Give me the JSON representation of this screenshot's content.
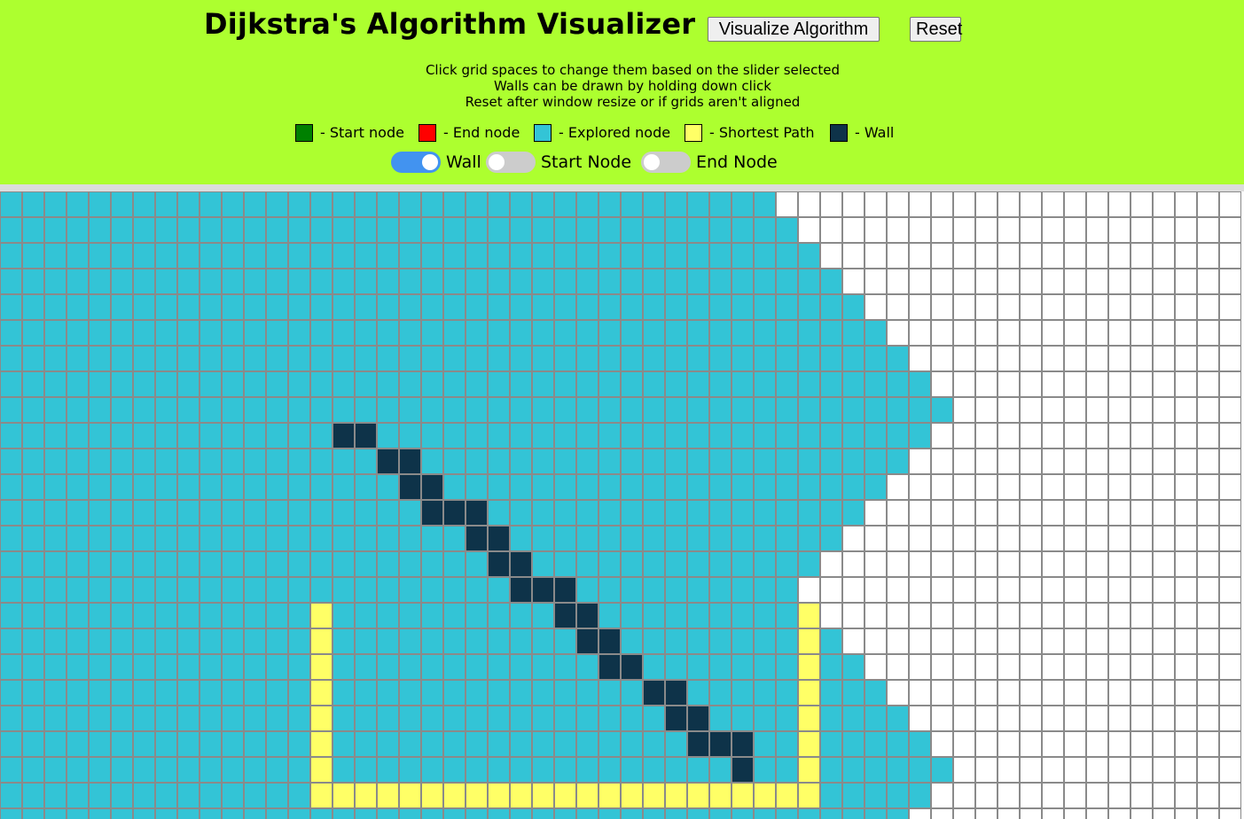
{
  "header": {
    "title": "Dijkstra's Algorithm Visualizer",
    "visualize_label": "Visualize Algorithm",
    "reset_label": "Reset",
    "instructions": [
      "Click grid spaces to change them based on the slider selected",
      "Walls can be drawn by holding down click",
      "Reset after window resize or if grids aren't aligned"
    ]
  },
  "legend": [
    {
      "label": "- Start node",
      "color": "#008000"
    },
    {
      "label": "- End node",
      "color": "#ff0000"
    },
    {
      "label": "- Explored node",
      "color": "#33c4d6"
    },
    {
      "label": "- Shortest Path",
      "color": "#ffff66"
    },
    {
      "label": "- Wall",
      "color": "#0e3349"
    }
  ],
  "toggles": [
    {
      "label": "Wall",
      "on": true
    },
    {
      "label": "Start Node",
      "on": false
    },
    {
      "label": "End Node",
      "on": false
    }
  ],
  "colors": {
    "header_bg": "#adff2f",
    "explored": "#33c4d6",
    "wall": "#0e3349",
    "path": "#ffff66",
    "empty": "#ffffff"
  },
  "grid": {
    "columns": 56,
    "visible_rows": 25,
    "explored_extent_per_row": [
      35,
      36,
      37,
      38,
      39,
      40,
      41,
      42,
      43,
      42,
      41,
      40,
      39,
      38,
      37,
      36,
      37,
      38,
      39,
      40,
      41,
      42,
      43,
      42
    ],
    "walls": [
      [
        9,
        15
      ],
      [
        9,
        16
      ],
      [
        10,
        17
      ],
      [
        10,
        18
      ],
      [
        11,
        18
      ],
      [
        11,
        19
      ],
      [
        12,
        19
      ],
      [
        12,
        20
      ],
      [
        12,
        21
      ],
      [
        13,
        21
      ],
      [
        13,
        22
      ],
      [
        14,
        22
      ],
      [
        14,
        23
      ],
      [
        15,
        23
      ],
      [
        15,
        24
      ],
      [
        15,
        25
      ],
      [
        16,
        25
      ],
      [
        16,
        26
      ],
      [
        17,
        26
      ],
      [
        17,
        27
      ],
      [
        18,
        27
      ],
      [
        18,
        28
      ],
      [
        19,
        29
      ],
      [
        19,
        30
      ],
      [
        20,
        30
      ],
      [
        20,
        31
      ],
      [
        21,
        31
      ],
      [
        21,
        32
      ],
      [
        21,
        33
      ],
      [
        22,
        33
      ]
    ],
    "path_left_column": 14,
    "path_right_column": 36,
    "path_rows": [
      16,
      17,
      18,
      19,
      20,
      21,
      22
    ],
    "path_bottom_row": 23
  }
}
